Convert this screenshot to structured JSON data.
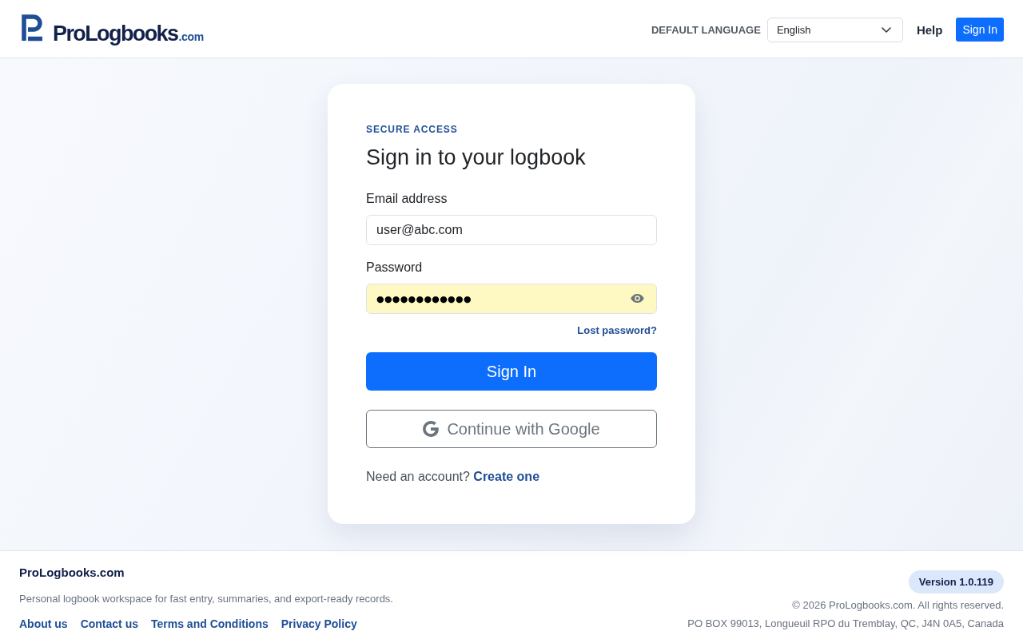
{
  "header": {
    "logo": {
      "name": "ProLogbooks",
      "suffix": ".com"
    },
    "language_label": "DEFAULT LANGUAGE",
    "language_select": {
      "value": "English"
    },
    "nav": [
      {
        "kind": "link",
        "label": "Help"
      },
      {
        "kind": "button",
        "label": "Sign In"
      }
    ]
  },
  "card": {
    "eyebrow": "SECURE ACCESS",
    "title": "Sign in to your logbook",
    "fields": [
      {
        "kind": "email",
        "label": "Email address",
        "value": "user@abc.com",
        "autofilled": false
      },
      {
        "kind": "password",
        "label": "Password",
        "value": "●●●●●●●●●●●●",
        "autofilled": true
      }
    ],
    "forgot_link": "Lost password?",
    "submit": "Sign In",
    "google_button": "Continue with Google",
    "signup": {
      "prompt": "Need an account?",
      "link": "Create one"
    }
  },
  "footer": {
    "brand": "ProLogbooks.com",
    "tagline": "Personal logbook workspace for fast entry, summaries, and export-ready records.",
    "links": [
      "About us",
      "Contact us",
      "Terms and Conditions",
      "Privacy Policy"
    ],
    "version": "Version 1.0.119",
    "copyright": "© 2026 ProLogbooks.com. All rights reserved.",
    "address": "PO BOX 99013, Longueuil RPO du Tremblay, QC, J4N 0A5, Canada"
  }
}
